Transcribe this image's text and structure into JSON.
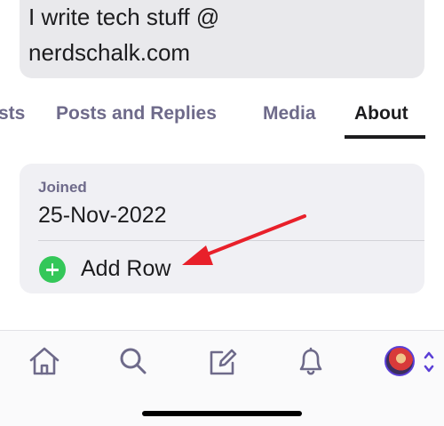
{
  "bio": {
    "line1": "I write tech stuff @",
    "line2": "nerdschalk.com"
  },
  "tabs": [
    {
      "label": "sts"
    },
    {
      "label": "Posts and Replies"
    },
    {
      "label": "Media"
    },
    {
      "label": "About",
      "active": true
    }
  ],
  "about": {
    "joined_label": "Joined",
    "joined_value": "25-Nov-2022",
    "add_row_label": "Add Row"
  },
  "tabbar": {
    "items": [
      "home-icon",
      "search-icon",
      "compose-icon",
      "bell-icon",
      "avatar",
      "account-switcher-icon"
    ]
  },
  "colors": {
    "accent": "#5b3fd6",
    "add_green": "#34c759",
    "arrow_red": "#e8202a",
    "muted_label": "#6e6a8a"
  }
}
